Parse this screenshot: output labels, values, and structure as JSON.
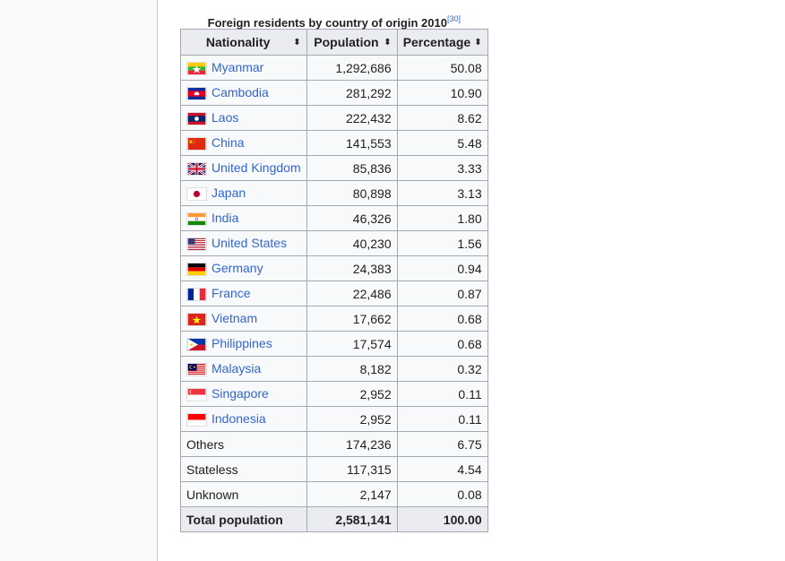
{
  "caption": {
    "title": "Foreign residents by country of origin 2010",
    "ref": "[30]"
  },
  "headers": {
    "nationality": "Nationality",
    "population": "Population",
    "percentage": "Percentage",
    "sort_icon": "⬍"
  },
  "rows": [
    {
      "name": "Myanmar",
      "population": "1,292,686",
      "percentage": "50.08",
      "flag": "myanmar-flag-icon",
      "link": true
    },
    {
      "name": "Cambodia",
      "population": "281,292",
      "percentage": "10.90",
      "flag": "cambodia-flag-icon",
      "link": true
    },
    {
      "name": "Laos",
      "population": "222,432",
      "percentage": "8.62",
      "flag": "laos-flag-icon",
      "link": true
    },
    {
      "name": "China",
      "population": "141,553",
      "percentage": "5.48",
      "flag": "china-flag-icon",
      "link": true
    },
    {
      "name": "United Kingdom",
      "population": "85,836",
      "percentage": "3.33",
      "flag": "uk-flag-icon",
      "link": true
    },
    {
      "name": "Japan",
      "population": "80,898",
      "percentage": "3.13",
      "flag": "japan-flag-icon",
      "link": true
    },
    {
      "name": "India",
      "population": "46,326",
      "percentage": "1.80",
      "flag": "india-flag-icon",
      "link": true
    },
    {
      "name": "United States",
      "population": "40,230",
      "percentage": "1.56",
      "flag": "us-flag-icon",
      "link": true
    },
    {
      "name": "Germany",
      "population": "24,383",
      "percentage": "0.94",
      "flag": "germany-flag-icon",
      "link": true
    },
    {
      "name": "France",
      "population": "22,486",
      "percentage": "0.87",
      "flag": "france-flag-icon",
      "link": true
    },
    {
      "name": "Vietnam",
      "population": "17,662",
      "percentage": "0.68",
      "flag": "vietnam-flag-icon",
      "link": true
    },
    {
      "name": "Philippines",
      "population": "17,574",
      "percentage": "0.68",
      "flag": "philippines-flag-icon",
      "link": true
    },
    {
      "name": "Malaysia",
      "population": "8,182",
      "percentage": "0.32",
      "flag": "malaysia-flag-icon",
      "link": true
    },
    {
      "name": "Singapore",
      "population": "2,952",
      "percentage": "0.11",
      "flag": "singapore-flag-icon",
      "link": true
    },
    {
      "name": "Indonesia",
      "population": "2,952",
      "percentage": "0.11",
      "flag": "indonesia-flag-icon",
      "link": true
    },
    {
      "name": "Others",
      "population": "174,236",
      "percentage": "6.75",
      "link": false
    },
    {
      "name": "Stateless",
      "population": "117,315",
      "percentage": "4.54",
      "link": false
    },
    {
      "name": "Unknown",
      "population": "2,147",
      "percentage": "0.08",
      "link": false
    }
  ],
  "total": {
    "name": "Total population",
    "population": "2,581,141",
    "percentage": "100.00"
  },
  "colors": {
    "link": "#3366cc",
    "header_bg": "#eaecf0",
    "cell_bg": "#f8f9fa",
    "border": "#a2a9b1"
  }
}
